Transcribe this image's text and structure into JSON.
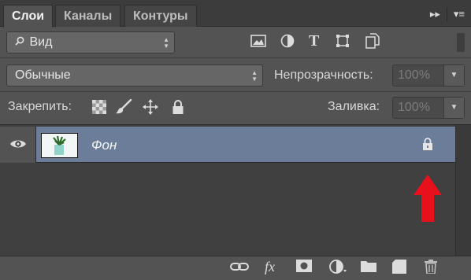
{
  "tabs": [
    {
      "label": "Слои",
      "active": true
    },
    {
      "label": "Каналы",
      "active": false
    },
    {
      "label": "Контуры",
      "active": false
    }
  ],
  "tab_menu": {
    "collapse_glyph": "▸▸",
    "menu_glyph": "▾≡"
  },
  "filter": {
    "kind_label": "Вид",
    "icons": [
      "image-filter-icon",
      "adjustment-filter-icon",
      "type-filter-icon",
      "shape-filter-icon",
      "smart-object-filter-icon"
    ],
    "type_glyph": "T"
  },
  "blend": {
    "mode": "Обычные",
    "opacity_label": "Непрозрачность:",
    "opacity_value": "100%"
  },
  "lock": {
    "label": "Закрепить:",
    "icons": [
      "lock-transparent-pixels-icon",
      "lock-image-pixels-icon",
      "lock-position-icon",
      "lock-all-icon"
    ],
    "fill_label": "Заливка:",
    "fill_value": "100%"
  },
  "layers": [
    {
      "name": "Фон",
      "visible": true,
      "locked": true
    }
  ],
  "annotation": {
    "arrow_color": "#e8101a"
  },
  "bottom_icons": [
    "link-layers-icon",
    "layer-style-fx-icon",
    "add-mask-icon",
    "adjustment-layer-icon",
    "new-group-icon",
    "new-layer-icon",
    "delete-layer-icon"
  ],
  "bottom_glyphs": {
    "fx": "fx"
  },
  "colors": {
    "panel_bg": "#535353",
    "selected_layer": "#6b7d99",
    "tab_bg": "#3c3c3c"
  }
}
